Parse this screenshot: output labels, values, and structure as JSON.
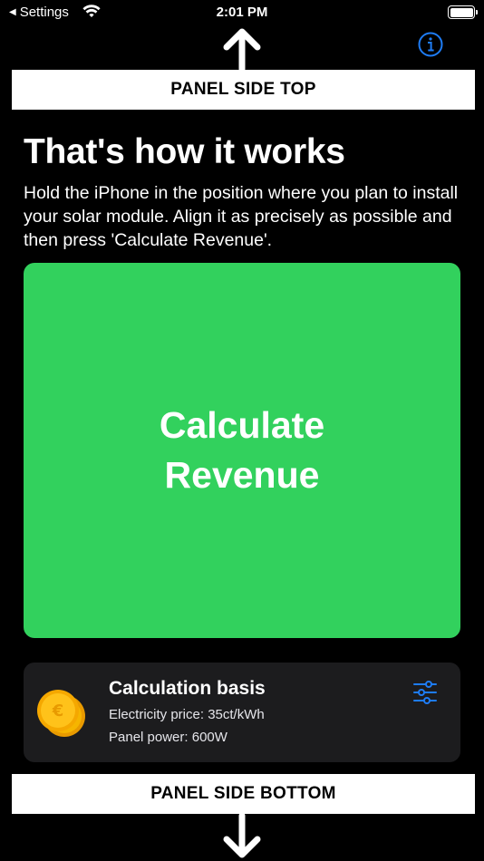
{
  "status_bar": {
    "back_label": "Settings",
    "time": "2:01 PM"
  },
  "panel": {
    "top_label": "PANEL SIDE TOP",
    "bottom_label": "PANEL SIDE BOTTOM"
  },
  "content": {
    "title": "That's how it works",
    "description": "Hold the iPhone in the position where you plan to install your solar module. Align it as precisely as possible and then press 'Calculate Revenue'.",
    "calculate_button_label": "Calculate Revenue"
  },
  "basis_card": {
    "title": "Calculation basis",
    "electricity_price": "Electricity price: 35ct/kWh",
    "panel_power": "Panel power: 600W"
  },
  "colors": {
    "accent_green": "#32d15d",
    "accent_blue": "#1e7cf5",
    "card_bg": "#1c1c1e",
    "coin_gold": "#f4b400"
  },
  "icons": {
    "back": "back-triangle-icon",
    "wifi": "wifi-icon",
    "battery": "battery-icon",
    "info": "info-icon",
    "arrow_up": "arrow-up-icon",
    "arrow_down": "arrow-down-icon",
    "coin": "euro-coin-icon",
    "settings": "sliders-icon"
  }
}
